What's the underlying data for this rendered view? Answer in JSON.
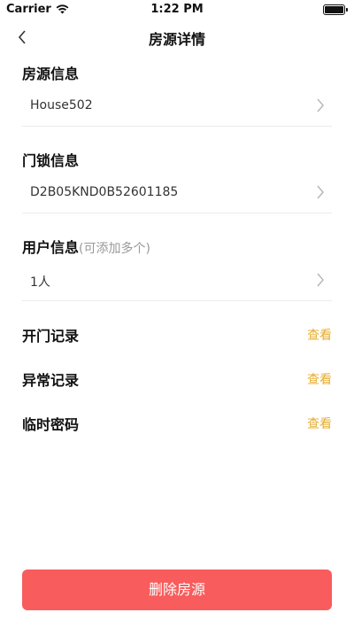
{
  "status_bar": {
    "carrier": "Carrier",
    "time": "1:22 PM"
  },
  "nav": {
    "title": "房源详情"
  },
  "house": {
    "title": "房源信息",
    "value": "House502"
  },
  "lock": {
    "title": "门锁信息",
    "value": "D2B05KND0B52601185"
  },
  "user": {
    "title": "用户信息",
    "hint": "(可添加多个)",
    "value": "1人"
  },
  "records": [
    {
      "label": "开门记录",
      "action": "查看"
    },
    {
      "label": "异常记录",
      "action": "查看"
    },
    {
      "label": "临时密码",
      "action": "查看"
    }
  ],
  "delete_button": {
    "label": "删除房源"
  },
  "colors": {
    "accent": "#e8ac2c",
    "danger": "#f85c5c"
  }
}
